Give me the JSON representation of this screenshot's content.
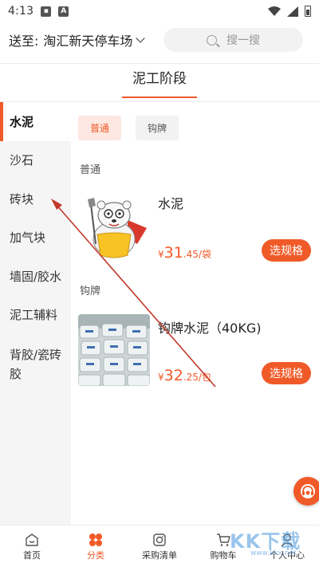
{
  "status_bar": {
    "time": "4:13",
    "icons": [
      "image-icon",
      "a-icon",
      "wifi-icon",
      "signal-icon",
      "battery-icon"
    ]
  },
  "header": {
    "deliver_to_label": "送至:",
    "address": "淘汇新天停车场",
    "search_placeholder": "搜一搜"
  },
  "stage": {
    "title": "泥工阶段"
  },
  "sidebar": {
    "items": [
      {
        "label": "水泥",
        "active": true
      },
      {
        "label": "沙石",
        "active": false
      },
      {
        "label": "砖块",
        "active": false
      },
      {
        "label": "加气块",
        "active": false
      },
      {
        "label": "墙固/胶水",
        "active": false
      },
      {
        "label": "泥工辅料",
        "active": false
      },
      {
        "label": "背胶/瓷砖胶",
        "active": false
      }
    ]
  },
  "filter_chips": [
    {
      "label": "普通",
      "active": true
    },
    {
      "label": "钩牌",
      "active": false
    }
  ],
  "sections": [
    {
      "label": "普通",
      "product": {
        "name": "水泥",
        "currency": "¥",
        "price_int": "31",
        "price_suffix": ".45/袋",
        "button": "选规格"
      }
    },
    {
      "label": "钩牌",
      "product": {
        "name": "钩牌水泥（40KG)",
        "currency": "¥",
        "price_int": "32",
        "price_suffix": ".25/包",
        "button": "选规格"
      }
    }
  ],
  "tabbar": {
    "tabs": [
      {
        "label": "首页",
        "icon": "home-icon",
        "active": false
      },
      {
        "label": "分类",
        "icon": "category-icon",
        "active": true
      },
      {
        "label": "采购清单",
        "icon": "purchase-list-icon",
        "active": false
      },
      {
        "label": "购物车",
        "icon": "cart-icon",
        "active": false
      },
      {
        "label": "个人中心",
        "icon": "user-icon",
        "active": false
      }
    ]
  },
  "watermark": {
    "text": "KK下载",
    "url": "www.kkx.net"
  },
  "colors": {
    "accent": "#f05a28",
    "sidebar_bg": "#f5f5f5",
    "chip_active_bg": "#fde9e2",
    "arrow": "#c0392b"
  }
}
